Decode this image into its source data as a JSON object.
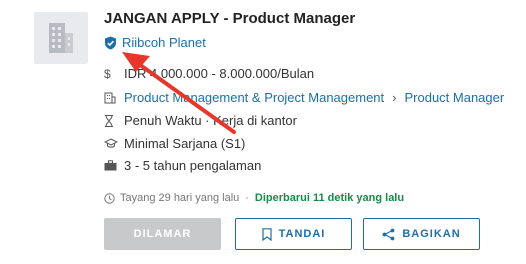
{
  "job": {
    "title": "JANGAN APPLY - Product Manager",
    "company": "Riibcoh Planet"
  },
  "details": {
    "salary": "IDR 4.000.000 - 8.000.000/Bulan",
    "category": "Product Management & Project Management",
    "category_separator": "›",
    "subcategory": "Product Manager",
    "work_type": "Penuh Waktu · Kerja di kantor",
    "education": "Minimal Sarjana (S1)",
    "experience": "3 - 5 tahun pengalaman"
  },
  "meta": {
    "posted": "Tayang 29 hari yang lalu",
    "separator": "·",
    "updated": "Diperbarui 11 detik yang lalu"
  },
  "actions": {
    "applied_label": "DILAMAR",
    "save_label": "TANDAI",
    "share_label": "BAGIKAN"
  },
  "colors": {
    "link": "#1d6fa8",
    "updated": "#1a8a4a",
    "annotation_arrow": "#e8372a",
    "disabled_button": "#c7c9cb"
  },
  "icons": {
    "logo": "building-icon",
    "verified": "shield-check-icon",
    "salary": "dollar-icon",
    "category": "building-icon",
    "work_type": "hourglass-icon",
    "education": "graduation-cap-icon",
    "experience": "briefcase-icon",
    "posted": "clock-icon",
    "save": "bookmark-icon",
    "share": "share-icon"
  }
}
